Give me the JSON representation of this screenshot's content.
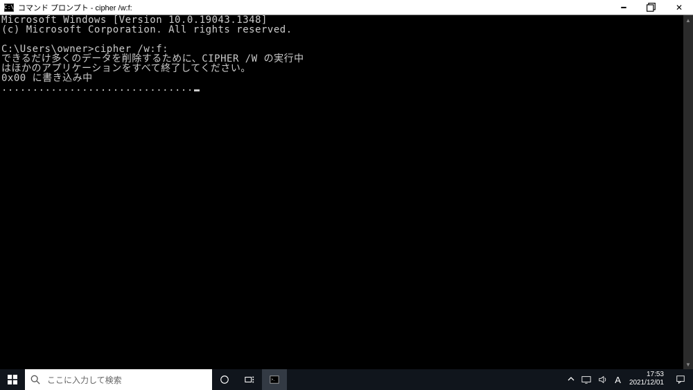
{
  "window": {
    "icon_text": "C:\\",
    "title": "コマンド プロンプト - cipher  /w:f:"
  },
  "console": {
    "line1": "Microsoft Windows [Version 10.0.19043.1348]",
    "line2": "(c) Microsoft Corporation. All rights reserved.",
    "blank1": "",
    "prompt": "C:\\Users\\owner>cipher /w:f:",
    "msg1": "できるだけ多くのデータを削除するために、CIPHER /W の実行中",
    "msg2": "はほかのアプリケーションをすべて終了してください。",
    "status": "0x00 に書き込み中",
    "dots": "..............................."
  },
  "taskbar": {
    "search_placeholder": "ここに入力して検索",
    "ime_mode": "A",
    "time": "17:53",
    "date": "2021/12/01"
  }
}
